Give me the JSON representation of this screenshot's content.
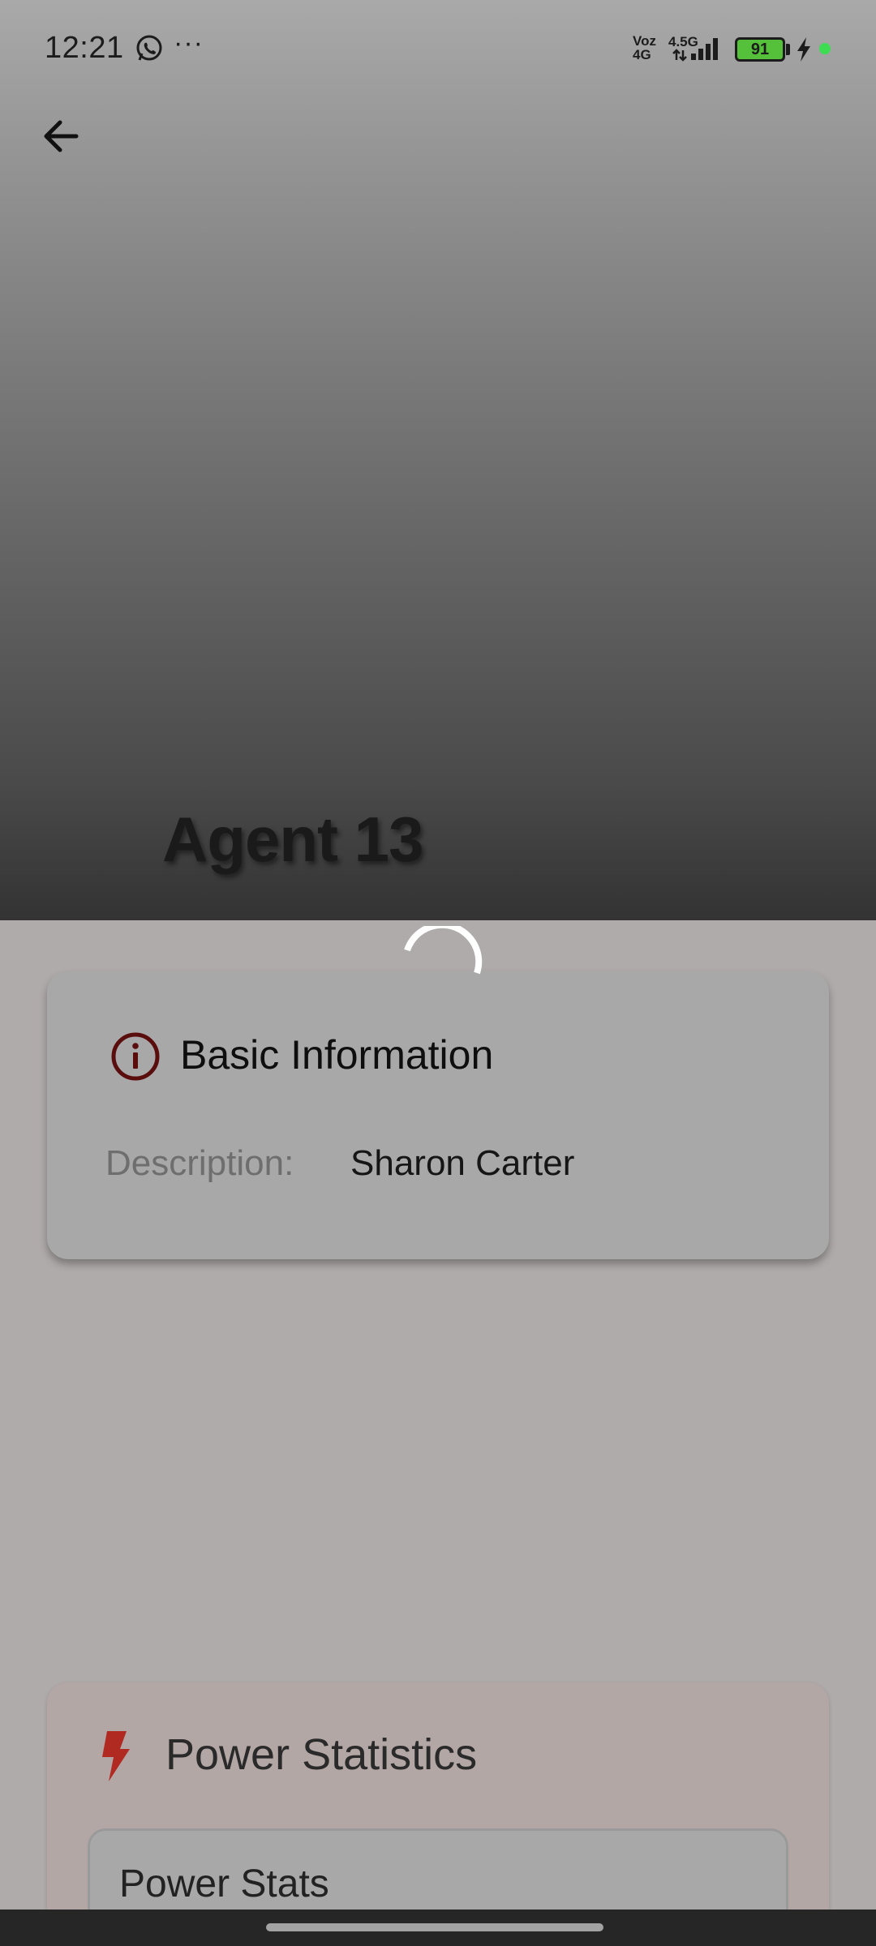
{
  "status_bar": {
    "time": "12:21",
    "more": "···",
    "network_top": "Voz",
    "network_bottom": "4G",
    "network_speed": "4.5G",
    "battery": "91",
    "notification_icons": [
      "whatsapp-icon",
      "more-icon"
    ],
    "system_icons": [
      "signal-icon",
      "battery-icon",
      "charging-icon"
    ]
  },
  "hero": {
    "title": "Agent 13",
    "back_icon": "arrow-left-icon"
  },
  "basic_info": {
    "title": "Basic Information",
    "icon": "info-icon",
    "description_label": "Description:",
    "description_value": "Sharon Carter"
  },
  "power_statistics": {
    "title": "Power Statistics",
    "icon": "bolt-icon",
    "subsection_title": "Power Stats"
  },
  "colors": {
    "info_icon": "#5a0d0d",
    "bolt_icon": "#b02a22",
    "battery_fill": "#55c03a"
  }
}
